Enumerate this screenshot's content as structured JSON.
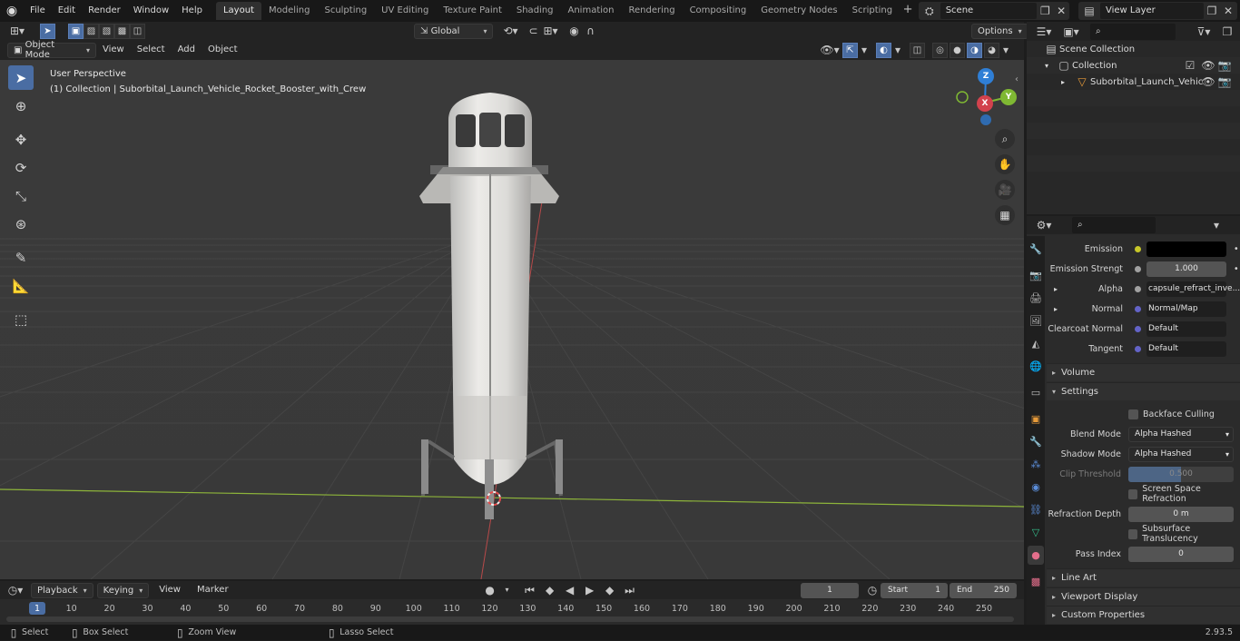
{
  "menus": [
    "File",
    "Edit",
    "Render",
    "Window",
    "Help"
  ],
  "workspaces": [
    "Layout",
    "Modeling",
    "Sculpting",
    "UV Editing",
    "Texture Paint",
    "Shading",
    "Animation",
    "Rendering",
    "Compositing",
    "Geometry Nodes",
    "Scripting"
  ],
  "scene": {
    "name": "Scene",
    "view_layer": "View Layer"
  },
  "viewport_header": {
    "transform_orientation": "Global",
    "options": "Options",
    "mode": "Object Mode",
    "menus": [
      "View",
      "Select",
      "Add",
      "Object"
    ]
  },
  "viewport": {
    "perspective": "User Perspective",
    "collection_info": "(1) Collection | Suborbital_Launch_Vehicle_Rocket_Booster_with_Crew",
    "axis_labels": {
      "z": "Z",
      "y": "Y",
      "x": "X"
    }
  },
  "outliner": {
    "scene_collection": "Scene Collection",
    "collection": "Collection",
    "object": "Suborbital_Launch_Vehic"
  },
  "properties": {
    "emission_label": "Emission",
    "emission_strength_label": "Emission Strengt",
    "emission_strength": "1.000",
    "alpha_label": "Alpha",
    "alpha_value": "capsule_refract_inve...",
    "normal_label": "Normal",
    "normal_value": "Normal/Map",
    "clearcoat_label": "Clearcoat Normal",
    "clearcoat_value": "Default",
    "tangent_label": "Tangent",
    "tangent_value": "Default",
    "volume": "Volume",
    "settings": "Settings",
    "backface": "Backface Culling",
    "blend_label": "Blend Mode",
    "blend_value": "Alpha Hashed",
    "shadow_label": "Shadow Mode",
    "shadow_value": "Alpha Hashed",
    "clip_label": "Clip Threshold",
    "clip_value": "0.500",
    "clip_fraction": 0.5,
    "ssr": "Screen Space Refraction",
    "refdepth_label": "Refraction Depth",
    "refdepth_value": "0 m",
    "sss": "Subsurface Translucency",
    "pass_label": "Pass Index",
    "pass_value": "0",
    "line_art": "Line Art",
    "viewport_display": "Viewport Display",
    "custom_props": "Custom Properties"
  },
  "timeline": {
    "menus": [
      "Playback",
      "Keying",
      "View",
      "Marker"
    ],
    "current_frame": "1",
    "start_label": "Start",
    "start": "1",
    "end_label": "End",
    "end": "250",
    "ruler": [
      "1",
      "10",
      "20",
      "30",
      "40",
      "50",
      "60",
      "70",
      "80",
      "90",
      "100",
      "110",
      "120",
      "130",
      "140",
      "150",
      "160",
      "170",
      "180",
      "190",
      "200",
      "210",
      "220",
      "230",
      "240",
      "250"
    ]
  },
  "status": {
    "select": "Select",
    "box_select": "Box Select",
    "zoom_view": "Zoom View",
    "lasso_select": "Lasso Select",
    "version": "2.93.5"
  },
  "colors": {
    "accent": "#4a6da3",
    "grid_x": "#8db43a",
    "grid_y": "#b84a4a",
    "z_axis": "#2f7fd6",
    "x_axis": "#d2424d",
    "y_axis": "#7fb833"
  }
}
